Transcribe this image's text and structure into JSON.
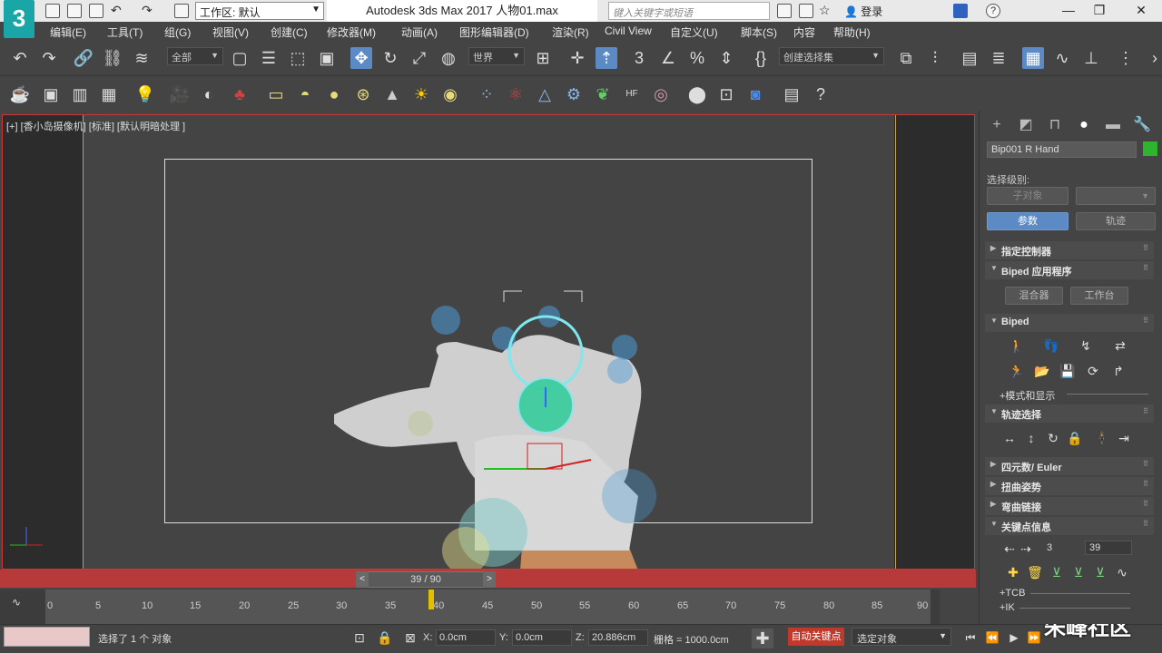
{
  "titlebar": {
    "logo": "3",
    "workspace_label": "工作区: 默认",
    "window_title": "Autodesk 3ds Max 2017     人物01.max",
    "search_placeholder": "键入关键字或短语",
    "login": "登录"
  },
  "menu": {
    "items": [
      "编辑(E)",
      "工具(T)",
      "组(G)",
      "视图(V)",
      "创建(C)",
      "修改器(M)",
      "动画(A)",
      "图形编辑器(D)",
      "渲染(R)",
      "Civil View",
      "自定义(U)",
      "脚本(S)",
      "内容",
      "帮助(H)"
    ]
  },
  "toolbar": {
    "selection_filter": "全部",
    "ref_coord": "世界",
    "named_selection": "创建选择集"
  },
  "viewport": {
    "label": "[+] [香小岛摄像机] [标准] [默认明暗处理 ]"
  },
  "timeslider": {
    "label": "39 / 90",
    "prev": "<",
    "next": ">"
  },
  "trackbar": {
    "ticks": [
      "0",
      "5",
      "10",
      "15",
      "20",
      "25",
      "30",
      "35",
      "40",
      "45",
      "50",
      "55",
      "60",
      "65",
      "70",
      "75",
      "80",
      "85",
      "90"
    ]
  },
  "status": {
    "message": "选择了 1 个 对象",
    "x_label": "X:",
    "x_value": "0.0cm",
    "y_label": "Y:",
    "y_value": "0.0cm",
    "z_label": "Z:",
    "z_value": "20.886cm",
    "grid": "栅格 = 1000.0cm",
    "autokey": "自动关键点",
    "selset": "选定对象"
  },
  "watermark": "朱峰社区",
  "cmdpanel": {
    "object_name": "Bip001 R Hand",
    "object_color": "#2db52d",
    "selection_level": "选择级别:",
    "sub_object": "子对象",
    "params_btn": "参数",
    "track_btn": "轨迹",
    "rollouts": {
      "assign_controller": "指定控制器",
      "biped_apps": "Biped 应用程序",
      "mixer": "混合器",
      "workbench": "工作台",
      "biped": "Biped",
      "mode_display": "+模式和显示",
      "track_selection": "轨迹选择",
      "quat_euler": "四元数/ Euler",
      "twist_poses": "扭曲姿势",
      "bend_links": "弯曲链接",
      "key_info": "关键点信息",
      "tcb": "+TCB",
      "ik": "+IK"
    },
    "key_info": {
      "key_number": "3",
      "frame": "39"
    }
  }
}
